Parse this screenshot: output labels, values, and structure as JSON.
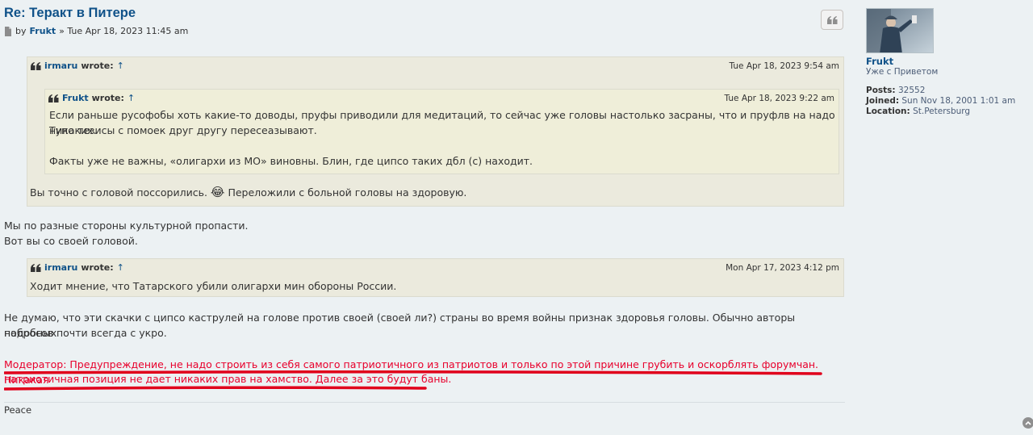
{
  "post": {
    "title": "Re: Теракт в Питере",
    "meta_by": "by",
    "author": "Frukt",
    "meta_sep_date": "» Tue Apr 18, 2023 11:45 am",
    "icons": {
      "post_icon": "file-icon",
      "quote_button": "quote-icon"
    }
  },
  "quote1": {
    "user": "irmaru",
    "wrote": "wrote:",
    "arrow": "↑",
    "date": "Tue Apr 18, 2023 9:54 am",
    "nested": {
      "user": "Frukt",
      "wrote": "wrote:",
      "arrow": "↑",
      "date": "Tue Apr 18, 2023 9:22 am",
      "line1": "Если раньше русофобы хоть какие-то доводы, пруфы приводили для медитаций, то сейчас уже головы настолько засраны, что и пруфлв на надо никаких.",
      "line2": "Тупо тезисы с помоек друг другу пересеазывают.",
      "line3": "Факты уже не важны, «олигархи из МО» виновны. Блин, где ципсо таких дбл (с) находит."
    },
    "text_before_emoji": "Вы точно с головой поссорились.",
    "emoji": "😂",
    "text_after_emoji": "Переложили с больной головы на здоровую."
  },
  "reply1": {
    "line1": "Мы по разные стороны культурной пропасти.",
    "line2": "Вот вы со своей головой."
  },
  "quote2": {
    "user": "irmaru",
    "wrote": "wrote:",
    "arrow": "↑",
    "date": "Mon Apr 17, 2023 4:12 pm",
    "text": "Ходит мнение, что Татарского убили олигархи мин обороны России."
  },
  "reply2": {
    "line1": "Не думаю, что эти скачки с ципсо каструлей на голове против своей (своей ли?) страны во время войны признак здоровья головы. Обычно авторы подобных",
    "line2": "набросов почти всегда с укро."
  },
  "moderator": {
    "line1": "Модератор: Предупреждение, не надо строить из себя самого патриотичного из патриотов и только по этой причине грубить и оскорблять форумчан. Никакая",
    "line2": "патриотичная позиция не дает никаких прав на хамство. Далее за это будут баны.",
    "color": "#e8002c",
    "underline_color": "#e0001b"
  },
  "signature": "Peace",
  "profile": {
    "name": "Frukt",
    "rank": "Уже с Приветом",
    "posts_label": "Posts:",
    "posts_value": "32552",
    "joined_label": "Joined:",
    "joined_value": "Sun Nov 18, 2001 1:01 am",
    "location_label": "Location:",
    "location_value": "St.Petersburg"
  },
  "colors": {
    "background": "#ecf1f3",
    "link": "#105289",
    "quote_bg": "#ebeadd",
    "nested_quote_bg": "#efeed9"
  }
}
